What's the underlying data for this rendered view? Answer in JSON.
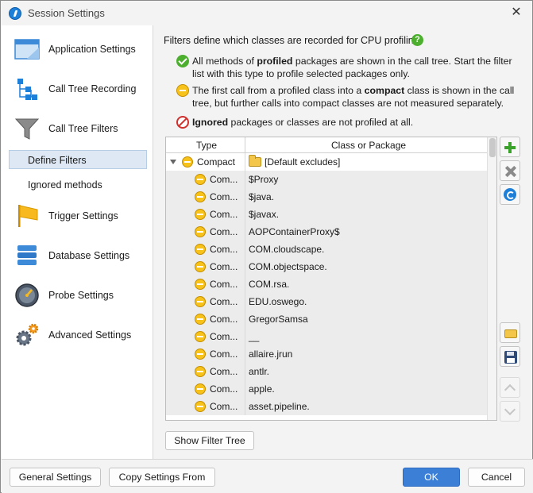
{
  "window": {
    "title": "Session Settings"
  },
  "sidebar": {
    "items": [
      {
        "label": "Application Settings",
        "icon": "application-window-icon"
      },
      {
        "label": "Call Tree Recording",
        "icon": "tree-hierarchy-icon"
      },
      {
        "label": "Call Tree Filters",
        "icon": "funnel-icon"
      },
      {
        "label": "Trigger Settings",
        "icon": "flag-icon"
      },
      {
        "label": "Database Settings",
        "icon": "database-icon"
      },
      {
        "label": "Probe Settings",
        "icon": "gauge-icon"
      },
      {
        "label": "Advanced Settings",
        "icon": "gears-icon"
      }
    ],
    "sub_items": [
      {
        "label": "Define Filters",
        "selected": true
      },
      {
        "label": "Ignored methods",
        "selected": false
      }
    ]
  },
  "content": {
    "intro": "Filters define which classes are recorded for CPU profiling.",
    "help": "?",
    "profiled": {
      "pre": "All methods of ",
      "bold": "profiled",
      "post": " packages are shown in the call tree. Start the filter",
      "line2": "list with this type to profile selected packages only."
    },
    "compact": {
      "pre": "The first call from a profiled class into a ",
      "bold": "compact",
      "post": " class is shown in the call",
      "line2": "tree, but further calls into compact classes are not measured separately."
    },
    "ignored": {
      "bold": "Ignored",
      "post": " packages or classes are not profiled at all."
    },
    "table": {
      "columns": [
        "Type",
        "Class or Package"
      ],
      "parent": {
        "type": "Compact",
        "package": "[Default excludes]"
      },
      "rows": [
        {
          "type": "Com...",
          "package": "$Proxy"
        },
        {
          "type": "Com...",
          "package": "$java."
        },
        {
          "type": "Com...",
          "package": "$javax."
        },
        {
          "type": "Com...",
          "package": "AOPContainerProxy$"
        },
        {
          "type": "Com...",
          "package": "COM.cloudscape."
        },
        {
          "type": "Com...",
          "package": "COM.objectspace."
        },
        {
          "type": "Com...",
          "package": "COM.rsa."
        },
        {
          "type": "Com...",
          "package": "EDU.oswego."
        },
        {
          "type": "Com...",
          "package": "GregorSamsa"
        },
        {
          "type": "Com...",
          "package": "__"
        },
        {
          "type": "Com...",
          "package": "allaire.jrun"
        },
        {
          "type": "Com...",
          "package": "antlr."
        },
        {
          "type": "Com...",
          "package": "apple."
        },
        {
          "type": "Com...",
          "package": "asset.pipeline."
        }
      ]
    },
    "show_filter_tree": "Show Filter Tree"
  },
  "footer": {
    "general_settings": "General Settings",
    "copy_settings_from": "Copy Settings From",
    "ok": "OK",
    "cancel": "Cancel"
  },
  "colors": {
    "primary_button": "#3c7fd6",
    "selection": "#dde8f4",
    "profiled": "#4caf2e",
    "compact": "#f7c21a",
    "ignored": "#d0312d"
  }
}
